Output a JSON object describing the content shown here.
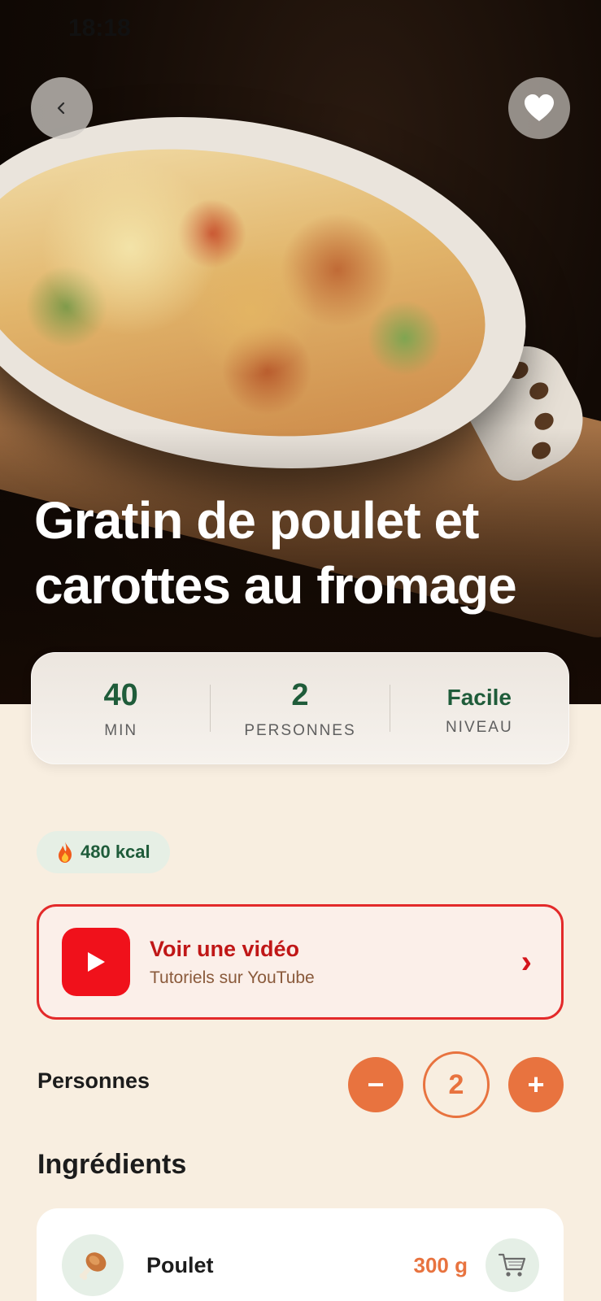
{
  "status_bar": {
    "time": "18:18"
  },
  "hero": {
    "title": "Gratin de poulet et carottes au fromage",
    "back_icon": "chevron-left-icon",
    "favorite_icon": "heart-icon"
  },
  "stats": [
    {
      "value": "40",
      "label": "MIN"
    },
    {
      "value": "2",
      "label": "PERSONNES"
    },
    {
      "value": "Facile",
      "label": "NIVEAU"
    }
  ],
  "calories": {
    "icon": "fire-icon",
    "text": "480 kcal"
  },
  "video": {
    "title": "Voir une vidéo",
    "subtitle": "Tutoriels sur YouTube",
    "icon": "youtube-icon",
    "chevron": "›"
  },
  "persons": {
    "label": "Personnes",
    "count": "2",
    "minus": "−",
    "plus": "+"
  },
  "ingredients": {
    "title": "Ingrédients",
    "items": [
      {
        "name": "Poulet",
        "quantity": "300 g",
        "icon": "chicken-leg-icon",
        "action_icon": "cart-icon"
      }
    ]
  },
  "colors": {
    "accent": "#e8733f",
    "green": "#1f5c3a",
    "youtube_red": "#f0111b",
    "background": "#f8eee0"
  }
}
